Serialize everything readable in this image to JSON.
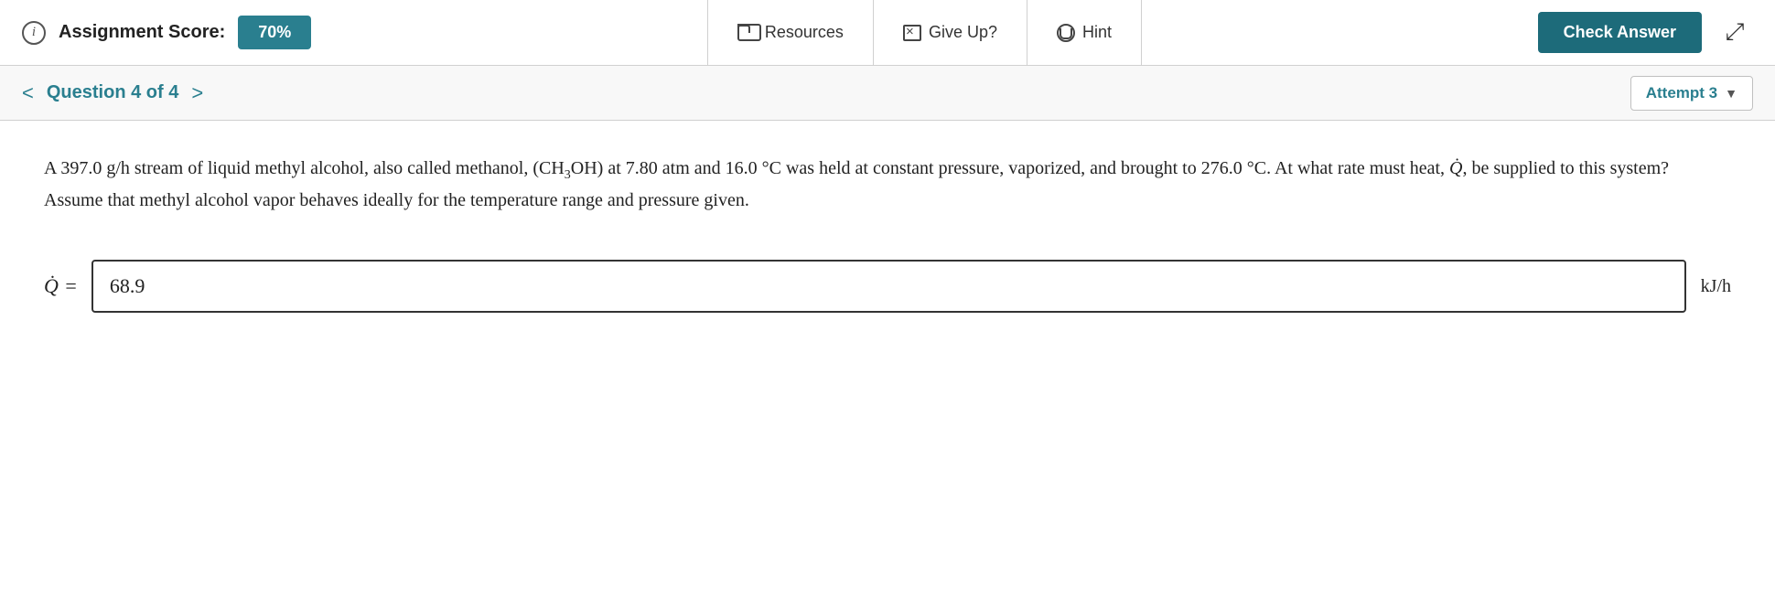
{
  "header": {
    "info_icon_label": "i",
    "assignment_score_label": "Assignment Score:",
    "score_value": "70%",
    "resources_label": "Resources",
    "give_up_label": "Give Up?",
    "hint_label": "Hint",
    "check_answer_label": "Check Answer"
  },
  "question_nav": {
    "prev_arrow": "<",
    "next_arrow": ">",
    "question_label": "Question 4 of 4",
    "attempt_label": "Attempt 3"
  },
  "question": {
    "text_part1": "A 397.0 g/h stream of liquid methyl alcohol, also called methanol, (CH",
    "text_sub": "3",
    "text_part2": "OH) at 7.80 atm and 16.0 °C was held at constant",
    "text_line2": "pressure, vaporized, and brought to 276.0 °C. At what rate must heat, ",
    "text_qdot": "Q̇",
    "text_line2b": ", be supplied to this system? Assume that methyl",
    "text_line3": "alcohol vapor behaves ideally for the temperature range and pressure given.",
    "answer_label": "Q̇ =",
    "answer_value": "68.9",
    "unit_label": "kJ/h"
  }
}
